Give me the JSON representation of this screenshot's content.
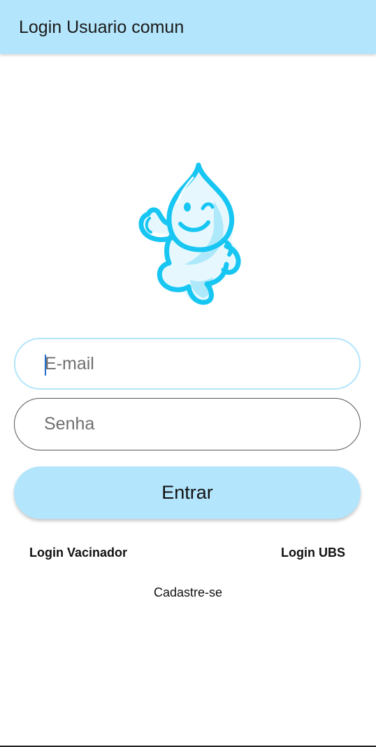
{
  "app_bar": {
    "title": "Login Usuario comun",
    "color": "#b3e5fc"
  },
  "mascot": {
    "icon": "water-drop-mascot-icon",
    "color": "#17c6f2"
  },
  "form": {
    "email": {
      "placeholder": "E-mail",
      "value": ""
    },
    "password": {
      "placeholder": "Senha",
      "value": ""
    },
    "submit_label": "Entrar"
  },
  "links": {
    "login_vacinador": "Login Vacinador",
    "login_ubs": "Login UBS",
    "cadastre": "Cadastre-se"
  }
}
